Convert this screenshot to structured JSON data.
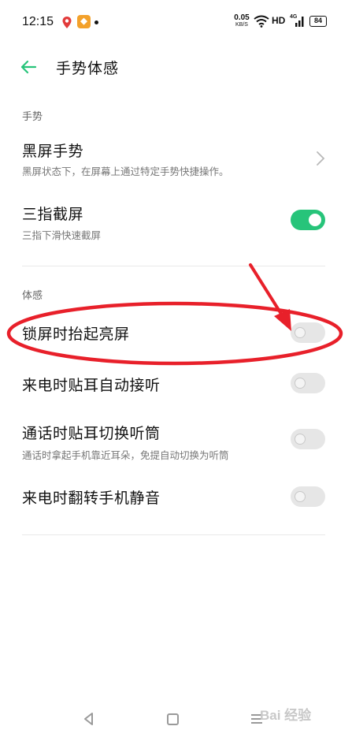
{
  "status_bar": {
    "time": "12:15",
    "net_speed_value": "0.05",
    "net_speed_unit": "KB/S",
    "hd": "HD",
    "network": "4G",
    "battery": "84"
  },
  "header": {
    "title": "手势体感",
    "back_icon": "arrow-left-icon",
    "accent_color": "#27c47a"
  },
  "sections": {
    "gesture": {
      "label": "手势",
      "items": [
        {
          "title": "黑屏手势",
          "subtitle": "黑屏状态下，在屏幕上通过特定手势快捷操作。",
          "control": "chevron"
        },
        {
          "title": "三指截屏",
          "subtitle": "三指下滑快速截屏",
          "control": "toggle",
          "enabled": true
        }
      ]
    },
    "motion": {
      "label": "体感",
      "items": [
        {
          "title": "锁屏时抬起亮屏",
          "control": "toggle",
          "enabled": false
        },
        {
          "title": "来电时贴耳自动接听",
          "control": "toggle",
          "enabled": false
        },
        {
          "title": "通话时贴耳切换听筒",
          "subtitle": "通话时拿起手机靠近耳朵，免提自动切换为听筒",
          "control": "toggle",
          "enabled": false
        },
        {
          "title": "来电时翻转手机静音",
          "control": "toggle",
          "enabled": false
        }
      ]
    }
  },
  "annotation": {
    "color": "#e8202a"
  },
  "watermark": "Bai 经验"
}
